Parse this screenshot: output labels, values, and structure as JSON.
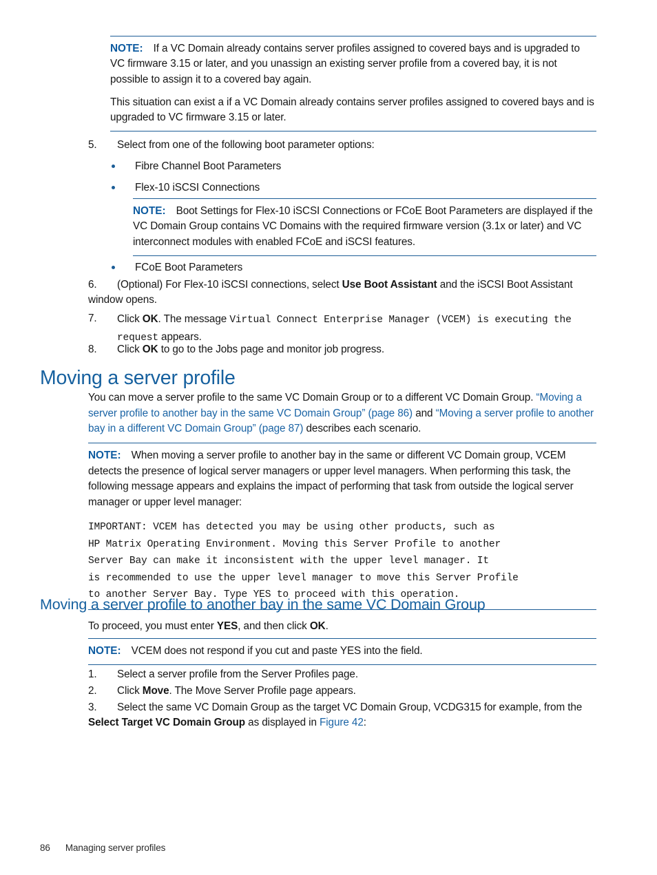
{
  "document": {
    "page_number": "86",
    "footer_section": "Managing server profiles"
  },
  "note_label": "NOTE:",
  "notes": {
    "covered_bays": {
      "label": "NOTE:",
      "para1": "If a VC Domain already contains server profiles assigned to covered bays and is upgraded to VC firmware 3.15 or later, and you unassign an existing server profile from a covered bay, it is not possible to assign it to a covered bay again.",
      "para2": "This situation can exist a if a VC Domain already contains server profiles assigned to covered bays and is upgraded to VC firmware 3.15 or later."
    },
    "boot_settings": {
      "label": "NOTE:",
      "text": "Boot Settings for Flex-10 iSCSI Connections or FCoE Boot Parameters are displayed if the VC Domain Group contains VC Domains with the required firmware version (3.1x or later) and VC interconnect modules with enabled FCoE and iSCSI features."
    },
    "moving_profile": {
      "label": "NOTE:",
      "text": "When moving a server profile to another bay in the same or different VC Domain group, VCEM detects the presence of logical server managers or upper level managers. When performing this task, the following message appears and explains the impact of performing that task from outside the logical server manager or upper level manager:"
    },
    "cut_paste": {
      "label": "NOTE:",
      "text": "VCEM does not respond if you cut and paste YES into the field."
    }
  },
  "steps_boot": {
    "step5": {
      "number": "5.",
      "text": "Select from one of the following boot parameter options:"
    },
    "bullets": [
      "Fibre Channel Boot Parameters",
      "Flex-10 iSCSI Connections",
      "FCoE Boot Parameters"
    ],
    "step6": {
      "number": "6.",
      "part1": "(Optional) For Flex-10 iSCSI connections, select ",
      "bold1": "Use Boot Assistant",
      "part2": " and the iSCSI Boot Assistant window opens."
    },
    "step7": {
      "number": "7.",
      "part1": "Click ",
      "bold1": "OK",
      "part2": ". The message ",
      "code": "Virtual Connect Enterprise Manager (VCEM) is executing the request",
      "part3": " appears."
    },
    "step8": {
      "number": "8.",
      "part1": "Click ",
      "bold1": "OK",
      "part2": " to go to the Jobs page and monitor job progress."
    }
  },
  "section_moving": {
    "heading": "Moving a server profile",
    "intro_line1": "You can move a server profile to the same VC Domain Group or to a different VC Domain Group.",
    "link1": "“Moving a server profile to another bay in the same VC Domain Group” (page 86)",
    "and_text": " and ",
    "link2": "“Moving a server profile to another bay in a different VC Domain Group” (page 87)",
    "tail_text": " describes each scenario."
  },
  "important_message": {
    "line1": "IMPORTANT: VCEM has detected you may be using other products, such as",
    "line2": "HP Matrix Operating Environment. Moving this Server Profile to another",
    "line3": "Server Bay can make it inconsistent with the upper level manager. It",
    "line4": "is recommended to use the upper level manager to move this Server Profile",
    "line5": "to another Server Bay. Type YES to proceed with this operation."
  },
  "subsection_same_group": {
    "heading": "Moving a server profile to another bay in the same VC Domain Group",
    "intro": {
      "part1": "To proceed, you must enter ",
      "bold1": "YES",
      "part2": ", and then click ",
      "bold2": "OK",
      "part3": "."
    },
    "steps": {
      "step1": {
        "number": "1.",
        "text": "Select a server profile from the Server Profiles page."
      },
      "step2": {
        "number": "2.",
        "part1": "Click ",
        "bold1": "Move",
        "part2": ". The Move Server Profile page appears."
      },
      "step3": {
        "number": "3.",
        "part1": "Select the same VC Domain Group as the target VC Domain Group, VCDG315 for example, from the ",
        "bold1": "Select Target VC Domain Group",
        "part2": " as displayed in ",
        "link": "Figure 42",
        "part3": ":"
      }
    }
  },
  "colors": {
    "heading_blue": "#17619f",
    "note_label_blue": "#0d5ba0",
    "rule_blue": "#1b5c96",
    "link_blue": "#1b64a5",
    "body_black": "#161616"
  }
}
